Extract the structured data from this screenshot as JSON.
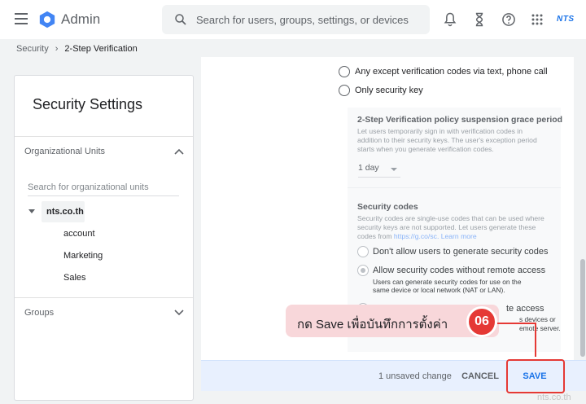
{
  "header": {
    "app_title": "Admin",
    "search_placeholder": "Search for users, groups, settings, or devices",
    "brand": "NTS"
  },
  "breadcrumb": {
    "parent": "Security",
    "current": "2-Step Verification"
  },
  "sidebar": {
    "title": "Security Settings",
    "org_units_label": "Organizational Units",
    "ou_search_placeholder": "Search for organizational units",
    "root_unit": "nts.co.th",
    "children": [
      "account",
      "Marketing",
      "Sales"
    ],
    "groups_label": "Groups"
  },
  "main": {
    "method_options": [
      {
        "label": "Any except verification codes via text, phone call",
        "selected": false
      },
      {
        "label": "Only security key",
        "selected": false
      }
    ],
    "grace_period": {
      "title": "2-Step Verification policy suspension grace period",
      "desc_line1": "Let users temporarily sign in with verification codes in",
      "desc_line2": "addition to their security keys. The user's exception period",
      "desc_line3": "starts when you generate verification codes.",
      "selected_value": "1 day"
    },
    "security_codes": {
      "title": "Security codes",
      "desc_line1": "Security codes are single-use codes that can be used where",
      "desc_line2": "security keys are not supported. Let users generate these",
      "desc_line3_prefix": "codes from ",
      "desc_link": "https://g.co/sc",
      "desc_line3_suffix": ". Learn more",
      "options": [
        {
          "label": "Don't allow users to generate security codes",
          "selected": false
        },
        {
          "label": "Allow security codes without remote access",
          "selected": true,
          "help1": "Users can generate security codes for use on the",
          "help2": "same device or local network (NAT or LAN)."
        },
        {
          "label_fragment": "te access",
          "help1_fragment": "s devices or",
          "help2_fragment": "emote server."
        }
      ]
    }
  },
  "footer": {
    "unsaved": "1 unsaved change",
    "cancel": "CANCEL",
    "save": "SAVE"
  },
  "annotation": {
    "text": "กด Save เพื่อบันทึกการตั้งค่า",
    "step": "06"
  },
  "watermark": "nts.co.th",
  "colors": {
    "accent": "#1a73e8",
    "annotation_red": "#e53935",
    "annotation_bg": "#f8d7da"
  }
}
